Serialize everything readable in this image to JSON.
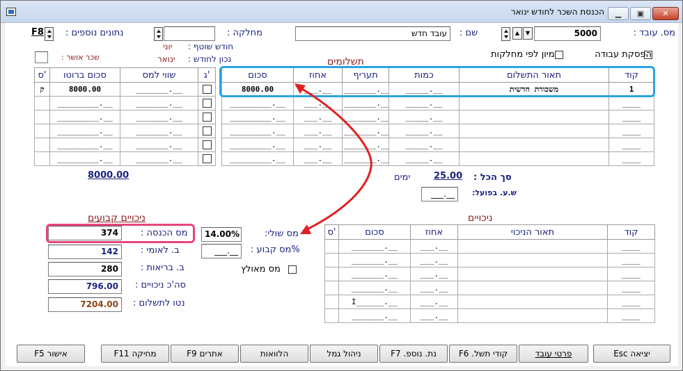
{
  "window": {
    "title": "הכנסת השכר לחודש ינואר",
    "min": "▁",
    "max": "▣",
    "close": "✕"
  },
  "header": {
    "employee_no_label": "מס. עובד :",
    "employee_no": "5000",
    "name_label": "שם :",
    "name_value": "עובד חדש",
    "dept_label": "מחלקה :",
    "dept_value": "",
    "extra_label": "נתונים נוספים :",
    "extra_key": "F8",
    "shared_month_label": "חודש שוטף :",
    "shared_month": "יוני",
    "correct_month_label": "נכון לחודש :",
    "correct_month": "ינואר",
    "approved_salary_label": "שכר אושר :",
    "stop_work_label": "הפסקת עבודה",
    "sort_by_dept_label": "מיון לפי מחלקות"
  },
  "payments": {
    "title": "תשלומים",
    "columns": [
      "קוד",
      "תאור התשלום",
      "כמות",
      "תעריף",
      "אחוז",
      "סכום"
    ],
    "rows": [
      {
        "code": "1",
        "desc": "משכורת חדשית",
        "qty": "_____.__",
        "rate": "_______.__",
        "pct": "___.__",
        "amount": "8000.00"
      },
      {
        "code": "____",
        "desc": "",
        "qty": "_____.__",
        "rate": "_______.__",
        "pct": "___.__",
        "amount": "_________.__"
      },
      {
        "code": "____",
        "desc": "",
        "qty": "_____.__",
        "rate": "_______.__",
        "pct": "___.__",
        "amount": "_________.__"
      },
      {
        "code": "____",
        "desc": "",
        "qty": "_____.__",
        "rate": "_______.__",
        "pct": "___.__",
        "amount": "_________.__"
      },
      {
        "code": "____",
        "desc": "",
        "qty": "_____.__",
        "rate": "_______.__",
        "pct": "___.__",
        "amount": "_________.__"
      },
      {
        "code": "____",
        "desc": "",
        "qty": "_____.__",
        "rate": "_______.__",
        "pct": "___.__",
        "amount": "_________.__"
      }
    ]
  },
  "gross": {
    "columns": [
      "ס'",
      "סכום ברוטו",
      "שווי למס",
      "ג'"
    ],
    "rows": [
      {
        "s": "ק",
        "gross": "8000.00",
        "tax_value": "_______.__"
      },
      {
        "s": "",
        "gross": "_________.__",
        "tax_value": "_______.__"
      },
      {
        "s": "",
        "gross": "_________.__",
        "tax_value": "_______.__"
      },
      {
        "s": "",
        "gross": "_________.__",
        "tax_value": "_______.__"
      },
      {
        "s": "",
        "gross": "_________.__",
        "tax_value": "_______.__"
      },
      {
        "s": "",
        "gross": "_________.__",
        "tax_value": "_______.__"
      }
    ],
    "total": "8000.00"
  },
  "totals": {
    "sum_all_label": "סך הכל :",
    "sum_all_value": "25.00",
    "days_label": "ימים",
    "actual_hours_label": "ש.ע. בפועל:",
    "actual_hours": "___.__"
  },
  "deductions": {
    "title": "ניכויים",
    "columns": [
      "קוד",
      "תאור הניכוי",
      "אחוז",
      "סכום",
      "ס'"
    ],
    "rows": [
      {
        "code": "____",
        "desc": "",
        "pct": "___.__",
        "amount": "_______.__"
      },
      {
        "code": "____",
        "desc": "",
        "pct": "___.__",
        "amount": "_______.__"
      },
      {
        "code": "____",
        "desc": "",
        "pct": "___.__",
        "amount": "_______.__"
      },
      {
        "code": "____",
        "desc": "",
        "pct": "___.__",
        "amount": "_______.__"
      },
      {
        "code": "____",
        "desc": "",
        "pct": "___.__",
        "amount": "I______.__"
      },
      {
        "code": "____",
        "desc": "",
        "pct": "___.__",
        "amount": "_______.__"
      }
    ]
  },
  "fixed": {
    "title": "ניכויים קבועים",
    "income_tax_label": "מס הכנסה :",
    "income_tax": "374",
    "social_sec_label": "ב. לאומי :",
    "social_sec": "142",
    "health_label": "ב. בריאות :",
    "health": "280",
    "total_deduct_label": "סה'כ ניכויים :",
    "total_deduct": "796.00",
    "net_label": "נטו לתשלום :",
    "net": "7204.00",
    "marginal_tax_label": "מס שולי:",
    "marginal_tax": "14.00%",
    "fixed_tax_label": "%מס קבוע :",
    "fixed_tax": "___.__",
    "tax_capital_label": "מס מאולץ"
  },
  "buttons": [
    {
      "key": "exit",
      "label": "יציאה Esc"
    },
    {
      "key": "emp",
      "label": "פרטי עובד"
    },
    {
      "key": "codes",
      "label": "קודי תשל. F6"
    },
    {
      "key": "extra",
      "label": "נת. נוספ. F7"
    },
    {
      "key": "pension",
      "label": "ניהול גמל"
    },
    {
      "key": "loans",
      "label": "הלוואות"
    },
    {
      "key": "search",
      "label": "אתרים F9"
    },
    {
      "key": "delete",
      "label": "מחיקה F11"
    },
    {
      "key": "approve",
      "label": "אישור F5"
    }
  ],
  "colors": {
    "highlight_blue": "#2aa4e0",
    "highlight_pink": "#e8457c",
    "arrow_red": "#e02020",
    "label_navy": "#1a237e",
    "label_brown": "#8b1a1a"
  }
}
